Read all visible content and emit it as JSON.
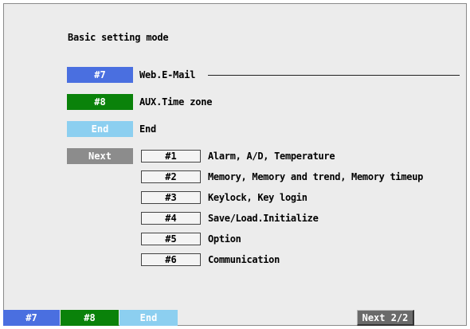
{
  "title": "Basic setting mode",
  "keys": [
    {
      "label": "#7",
      "text": "Web.E-Mail",
      "color": "#4a6fe0"
    },
    {
      "label": "#8",
      "text": "AUX.Time zone",
      "color": "#0a820a"
    },
    {
      "label": "End",
      "text": "End",
      "color": "#8ccff0"
    },
    {
      "label": "Next",
      "text": "",
      "color": "#8c8c8c"
    }
  ],
  "menu": [
    {
      "label": "#1",
      "text": "Alarm, A/D, Temperature"
    },
    {
      "label": "#2",
      "text": "Memory, Memory and trend, Memory timeup"
    },
    {
      "label": "#3",
      "text": "Keylock, Key login"
    },
    {
      "label": "#4",
      "text": "Save/Load.Initialize"
    },
    {
      "label": "#5",
      "text": "Option"
    },
    {
      "label": "#6",
      "text": "Communication"
    }
  ],
  "softkeys": [
    {
      "label": "#7",
      "color": "#4a6fe0"
    },
    {
      "label": "#8",
      "color": "#0a820a"
    },
    {
      "label": "End",
      "color": "#8ccff0"
    },
    {
      "label": "Next 2/2",
      "color": "#6a6a6a"
    }
  ]
}
